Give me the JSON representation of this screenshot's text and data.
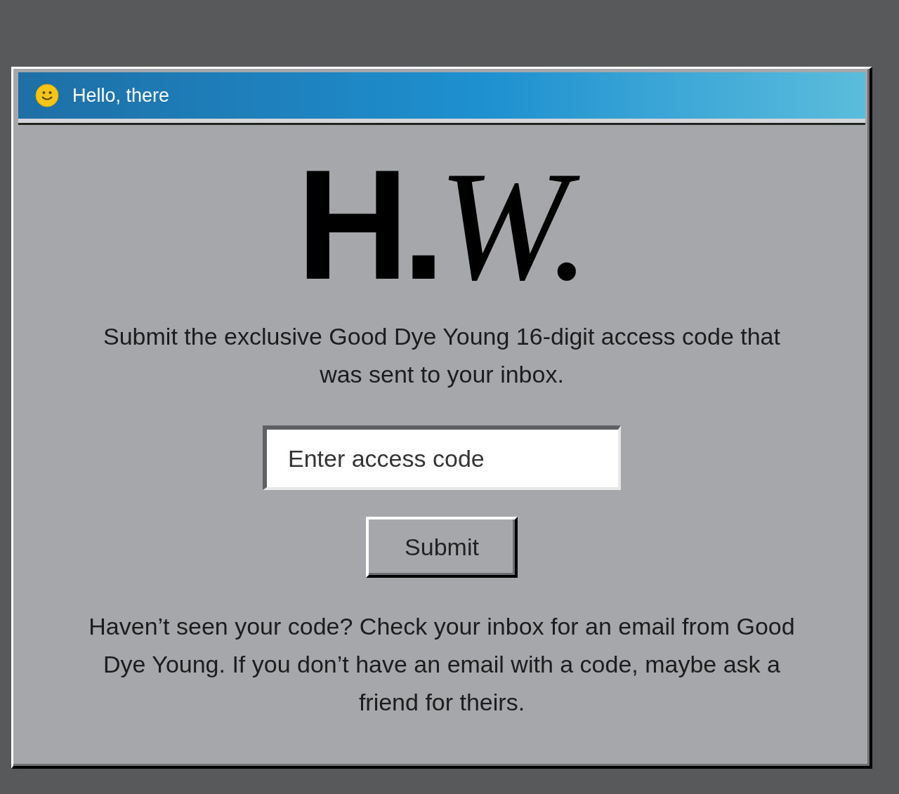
{
  "window": {
    "title": "Hello, there"
  },
  "logo": {
    "text": "H.*W.*"
  },
  "intro": "Submit the exclusive Good Dye Young 16-digit access code that was sent to your inbox.",
  "access_field": {
    "placeholder": "Enter access code"
  },
  "submit_button": {
    "label": "Submit"
  },
  "help": "Haven’t seen your code? Check your inbox for an email from Good Dye Young. If you don’t have an email with a code, maybe ask a friend for theirs."
}
